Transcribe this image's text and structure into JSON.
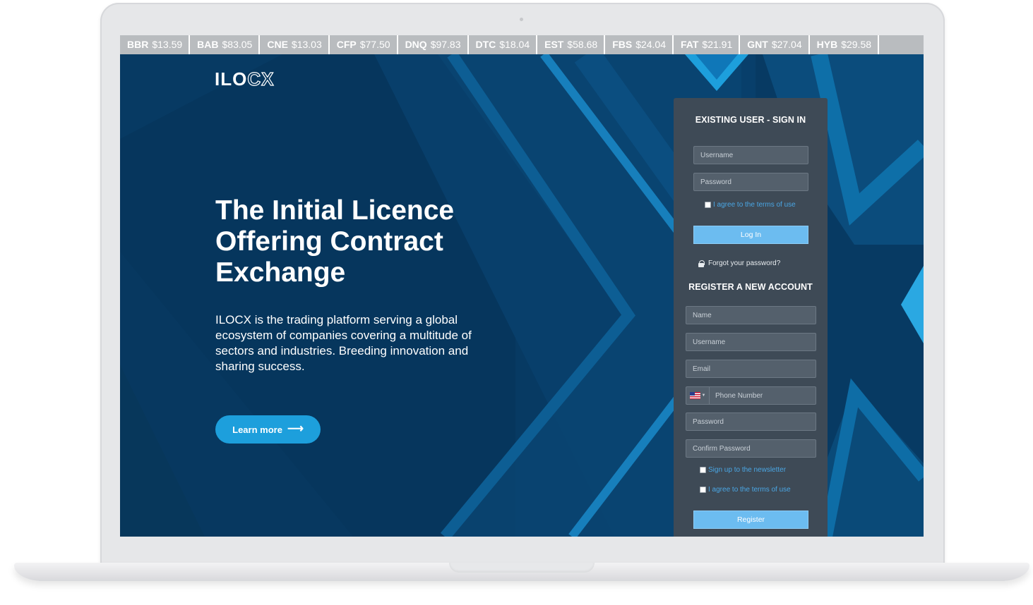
{
  "ticker": [
    {
      "symbol": "BBR",
      "price": "$13.59"
    },
    {
      "symbol": "BAB",
      "price": "$83.05"
    },
    {
      "symbol": "CNE",
      "price": "$13.03"
    },
    {
      "symbol": "CFP",
      "price": "$77.50"
    },
    {
      "symbol": "DNQ",
      "price": "$97.83"
    },
    {
      "symbol": "DTC",
      "price": "$18.04"
    },
    {
      "symbol": "EST",
      "price": "$58.68"
    },
    {
      "symbol": "FBS",
      "price": "$24.04"
    },
    {
      "symbol": "FAT",
      "price": "$21.91"
    },
    {
      "symbol": "GNT",
      "price": "$27.04"
    },
    {
      "symbol": "HYB",
      "price": "$29.58"
    }
  ],
  "logo": {
    "solid": "ILO",
    "outline": "CX"
  },
  "hero": {
    "headline": "The Initial Licence Offering Contract Exchange",
    "description": "ILOCX is the trading platform serving a global ecosystem of companies covering a multitude of sectors and industries. Breeding innovation and sharing success.",
    "learn_more": "Learn more",
    "arrow_icon": "arrow-right-icon"
  },
  "sign_in": {
    "title": "EXISTING USER - SIGN IN",
    "username_placeholder": "Username",
    "password_placeholder": "Password",
    "terms_label": "I agree to the terms of use",
    "login_label": "Log In",
    "forgot_label": "Forgot your password?"
  },
  "register": {
    "title": "REGISTER A NEW ACCOUNT",
    "name_placeholder": "Name",
    "username_placeholder": "Username",
    "email_placeholder": "Email",
    "phone_placeholder": "Phone Number",
    "password_placeholder": "Password",
    "confirm_placeholder": "Confirm Password",
    "newsletter_label": "Sign up to the newsletter",
    "terms_label": "I agree to the terms of use",
    "register_label": "Register"
  },
  "colors": {
    "background": "#073a63",
    "accent": "#1d9fdc",
    "panel": "#3e4a56",
    "button": "#6cbcf0",
    "link": "#4aa6e4"
  }
}
